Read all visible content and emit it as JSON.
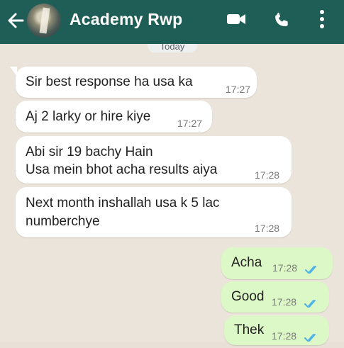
{
  "header": {
    "title": "Academy Rwp",
    "back_icon": "back-arrow-icon",
    "video_icon": "video-call-icon",
    "call_icon": "phone-icon",
    "menu_icon": "more-options-icon"
  },
  "date_chip": "Today",
  "messages": [
    {
      "text": "Sir best response ha usa ka",
      "time": "17:27",
      "direction": "incoming"
    },
    {
      "text": "Aj 2 larky or hire kiye",
      "time": "17:27",
      "direction": "incoming"
    },
    {
      "text_line1": "Abi sir 19 bachy Hain",
      "text_line2": "Usa mein bhot acha results aiya",
      "time": "17:28",
      "direction": "incoming"
    },
    {
      "text_line1": "Next month inshallah usa k 5 lac",
      "text_line2": "numberchye",
      "time": "17:28",
      "direction": "incoming"
    },
    {
      "text": "Acha",
      "time": "17:28",
      "direction": "outgoing",
      "status": "read"
    },
    {
      "text": "Good",
      "time": "17:28",
      "direction": "outgoing",
      "status": "read"
    },
    {
      "text": "Thek",
      "time": "17:28",
      "direction": "outgoing",
      "status": "read"
    }
  ],
  "colors": {
    "header": "#1f5e56",
    "incoming_bubble": "#ffffff",
    "outgoing_bubble": "#dcf8c6",
    "read_tick": "#4fb3e6"
  }
}
